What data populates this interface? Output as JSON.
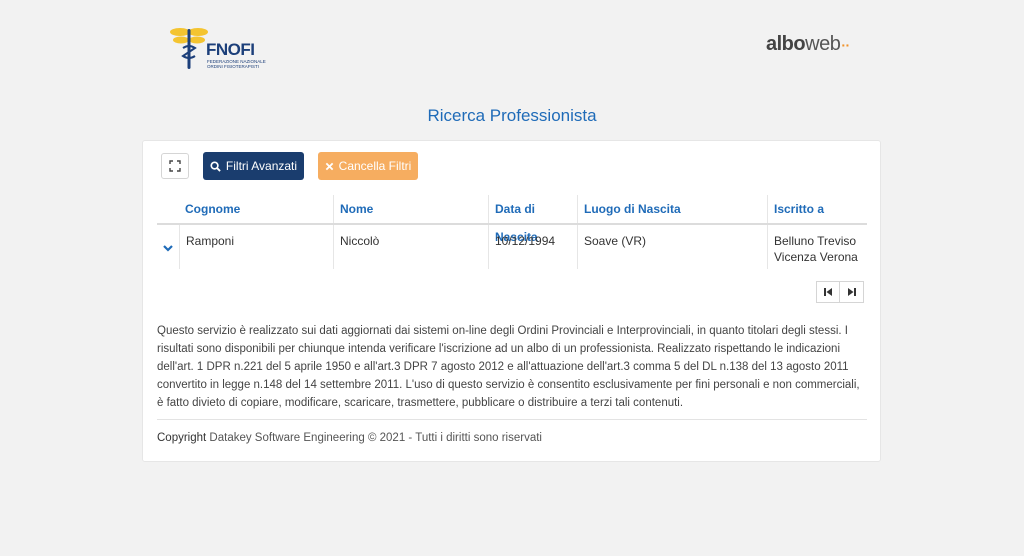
{
  "header": {
    "fnofi_logo": {
      "name": "FNOFI",
      "subtitle_line1": "FEDERAZIONE NAZIONALE",
      "subtitle_line2": "ORDINI FISIOTERAPISTI"
    },
    "alboweb_logo": {
      "part1": "albo",
      "part2": "web",
      "dots": "··"
    }
  },
  "page_title": "Ricerca Professionista",
  "toolbar": {
    "expand_icon": "expand-icon",
    "filters_label": "Filtri Avanzati",
    "filters_icon": "search-icon",
    "clear_label": "Cancella Filtri",
    "clear_icon": "close-icon"
  },
  "table": {
    "columns": [
      "Cognome",
      "Nome",
      "Data di Nascita",
      "Luogo di Nascita",
      "Iscritto a"
    ],
    "rows": [
      {
        "cognome": "Ramponi",
        "nome": "Niccolò",
        "data_nascita": "10/12/1994",
        "luogo_nascita": "Soave (VR)",
        "iscritto_a": [
          "Belluno Treviso",
          "Vicenza Verona"
        ]
      }
    ]
  },
  "pagination": {
    "first_icon": "skip-first-icon",
    "last_icon": "skip-last-icon"
  },
  "disclaimer": "Questo servizio è realizzato sui dati aggiornati dai sistemi on-line degli Ordini Provinciali e Interprovinciali, in quanto titolari degli stessi. I risultati sono disponibili per chiunque intenda verificare l'iscrizione ad un albo di un professionista. Realizzato rispettando le indicazioni dell'art. 1 DPR n.221 del 5 aprile 1950 e all'art.3 DPR 7 agosto 2012 e all'attuazione dell'art.3 comma 5 del DL n.138 del 13 agosto 2011 convertito in legge n.148 del 14 settembre 2011. L'uso di questo servizio è consentito esclusivamente per fini personali e non commerciali, è fatto divieto di copiare, modificare, scaricare, trasmettere, pubblicare o distribuire a terzi tali contenuti.",
  "footer": {
    "copyright_label": "Copyright",
    "copyright_text": "Datakey Software Engineering © 2021 - Tutti i diritti sono riservati"
  },
  "colors": {
    "primary": "#1a3d6e",
    "accent_blue": "#1f6bb8",
    "orange": "#f6ad60",
    "background": "#f2f2f2"
  }
}
